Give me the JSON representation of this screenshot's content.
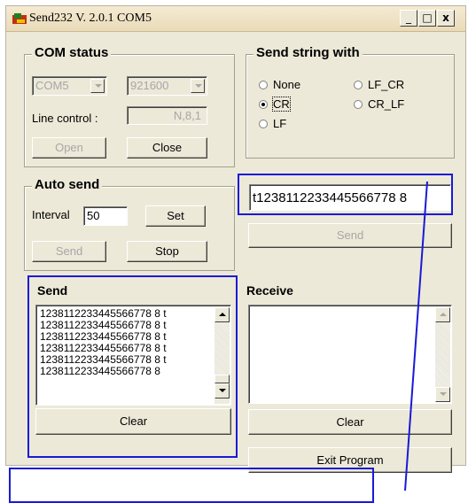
{
  "window": {
    "title": "Send232  V. 2.0.1  COM5",
    "min_glyph": "_",
    "max_glyph": "□",
    "close_glyph": "x"
  },
  "com_status": {
    "title": "COM status",
    "port": "COM5",
    "baud": "921600",
    "line_control_label": "Line control :",
    "line_control_value": "N,8,1",
    "open_label": "Open",
    "close_label": "Close"
  },
  "send_string_with": {
    "title": "Send string with",
    "options": [
      {
        "label": "None",
        "checked": false
      },
      {
        "label": "LF_CR",
        "checked": false
      },
      {
        "label": "CR",
        "checked": true
      },
      {
        "label": "CR_LF",
        "checked": false
      },
      {
        "label": "LF",
        "checked": false
      }
    ]
  },
  "auto_send": {
    "title": "Auto send",
    "interval_label": "Interval",
    "interval_value": "50",
    "set_label": "Set",
    "send_label": "Send",
    "stop_label": "Stop"
  },
  "input": {
    "value": "t1238112233445566778 8",
    "send_label": "Send"
  },
  "send_panel": {
    "title": "Send",
    "lines": [
      "1238112233445566778 8  t",
      "1238112233445566778 8  t",
      "1238112233445566778 8  t",
      "1238112233445566778 8  t",
      "1238112233445566778 8  t",
      "1238112233445566778 8"
    ],
    "clear_label": "Clear"
  },
  "receive_panel": {
    "title": "Receive",
    "clear_label": "Clear"
  },
  "exit_label": "Exit Program",
  "colors": {
    "highlight": "#1a1ad6",
    "window_bg": "#ece9d8",
    "disabled_text": "#a7a7a7"
  }
}
